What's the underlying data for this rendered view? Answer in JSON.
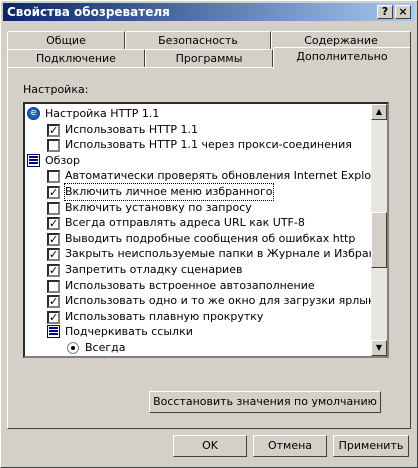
{
  "window": {
    "title": "Свойства обозревателя",
    "help_btn": "?",
    "close_btn": "×"
  },
  "tabs_row1": [
    "Общие",
    "Безопасность",
    "Содержание"
  ],
  "tabs_row2": [
    "Подключение",
    "Программы",
    "Дополнительно"
  ],
  "active_tab": "Дополнительно",
  "settings_label": "Настройка:",
  "list": {
    "items": [
      {
        "kind": "group-http",
        "label": "Настройка HTTP 1.1",
        "indent": 0
      },
      {
        "kind": "check",
        "checked": true,
        "label": "Использовать HTTP 1.1",
        "indent": 1
      },
      {
        "kind": "check",
        "checked": false,
        "label": "Использовать HTTP 1.1 через прокси-соединения",
        "indent": 1
      },
      {
        "kind": "group-browse",
        "label": "Обзор",
        "indent": 0
      },
      {
        "kind": "check",
        "checked": false,
        "label": "Автоматически проверять обновления Internet Explorer.",
        "indent": 1
      },
      {
        "kind": "check",
        "checked": true,
        "label": "Включить личное меню избранного",
        "indent": 1,
        "focused": true
      },
      {
        "kind": "check",
        "checked": false,
        "label": "Включить установку по запросу",
        "indent": 1
      },
      {
        "kind": "check",
        "checked": true,
        "label": "Всегда отправлять адреса URL как UTF-8",
        "indent": 1
      },
      {
        "kind": "check",
        "checked": true,
        "label": "Выводить подробные сообщения об ошибках http",
        "indent": 1
      },
      {
        "kind": "check",
        "checked": true,
        "label": "Закрыть неиспользуемые папки в Журнале и Избранном",
        "indent": 1
      },
      {
        "kind": "check",
        "checked": true,
        "label": "Запретить отладку сценариев",
        "indent": 1
      },
      {
        "kind": "check",
        "checked": false,
        "label": "Использовать встроенное автозаполнение",
        "indent": 1
      },
      {
        "kind": "check",
        "checked": true,
        "label": "Использовать одно и то же окно для загрузки ярлыков",
        "indent": 1
      },
      {
        "kind": "check",
        "checked": true,
        "label": "Использовать плавную прокрутку",
        "indent": 1
      },
      {
        "kind": "group-browse",
        "label": "Подчеркивать ссылки",
        "indent": 1
      },
      {
        "kind": "radio",
        "checked": true,
        "label": "Всегда",
        "indent": 2
      }
    ]
  },
  "restore_defaults": "Восстановить значения по умолчанию",
  "buttons": {
    "ok": "OK",
    "cancel": "Отмена",
    "apply": "Применить"
  }
}
